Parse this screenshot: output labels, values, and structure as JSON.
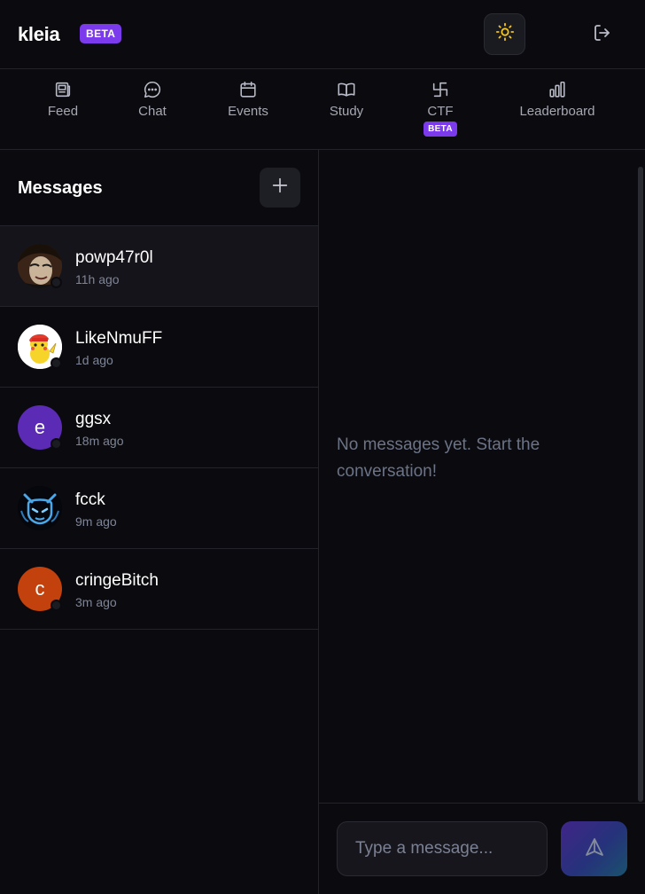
{
  "app": {
    "name": "kleia",
    "badge": "BETA"
  },
  "nav": [
    {
      "label": "Feed",
      "icon": "newspaper-icon"
    },
    {
      "label": "Chat",
      "icon": "chat-bubble-icon"
    },
    {
      "label": "Events",
      "icon": "calendar-icon"
    },
    {
      "label": "Study",
      "icon": "book-icon"
    },
    {
      "label": "CTF",
      "icon": "flag-icon",
      "badge": "BETA"
    },
    {
      "label": "Leaderboard",
      "icon": "bar-chart-icon"
    }
  ],
  "sidebar": {
    "title": "Messages",
    "conversations": [
      {
        "name": "powp47r0l",
        "time": "11h ago",
        "avatar": "photo",
        "active": true
      },
      {
        "name": "LikeNmuFF",
        "time": "1d ago",
        "avatar": "photo"
      },
      {
        "name": "ggsx",
        "time": "18m ago",
        "avatar": "initial",
        "initial": "e",
        "color": "#5b2bb5"
      },
      {
        "name": "fcck",
        "time": "9m ago",
        "avatar": "photo"
      },
      {
        "name": "cringeBitch",
        "time": "3m ago",
        "avatar": "initial",
        "initial": "c",
        "color": "#c2410c"
      }
    ]
  },
  "chat": {
    "empty_message": "No messages yet. Start the conversation!",
    "input_placeholder": "Type a message..."
  },
  "colors": {
    "accent": "#7c3aed",
    "sun": "#f5c518",
    "background": "#0b0b0f"
  }
}
